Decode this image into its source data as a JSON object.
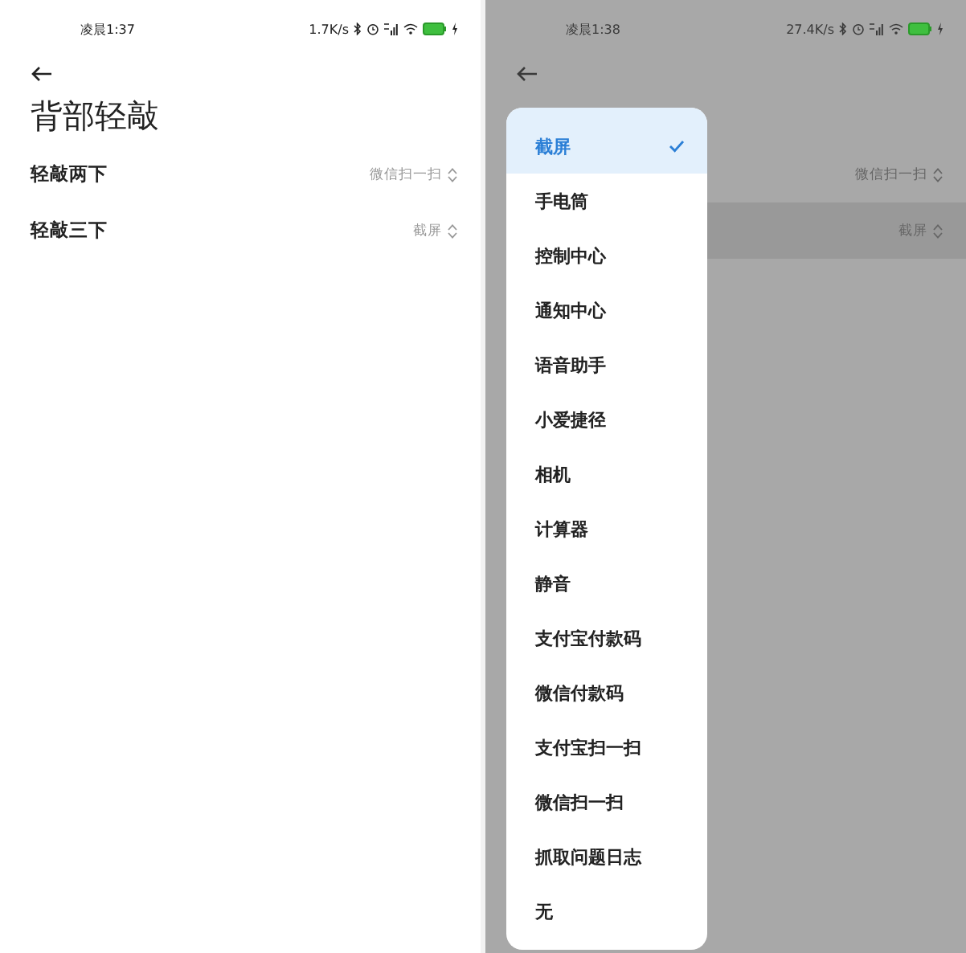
{
  "screens": [
    {
      "dimmed": false,
      "status_bar": {
        "time": "凌晨1:37",
        "net_speed": "1.7K/s"
      },
      "title": "背部轻敲",
      "settings": [
        {
          "label": "轻敲两下",
          "value": "微信扫一扫",
          "pressed": false
        },
        {
          "label": "轻敲三下",
          "value": "截屏",
          "pressed": false
        }
      ]
    },
    {
      "dimmed": true,
      "status_bar": {
        "time": "凌晨1:38",
        "net_speed": "27.4K/s"
      },
      "settings": [
        {
          "value": "微信扫一扫",
          "pressed": false
        },
        {
          "value": "截屏",
          "pressed": true
        }
      ],
      "menu": {
        "items": [
          {
            "label": "截屏",
            "selected": true
          },
          {
            "label": "手电筒",
            "selected": false
          },
          {
            "label": "控制中心",
            "selected": false
          },
          {
            "label": "通知中心",
            "selected": false
          },
          {
            "label": "语音助手",
            "selected": false
          },
          {
            "label": "小爱捷径",
            "selected": false
          },
          {
            "label": "相机",
            "selected": false
          },
          {
            "label": "计算器",
            "selected": false
          },
          {
            "label": "静音",
            "selected": false
          },
          {
            "label": "支付宝付款码",
            "selected": false
          },
          {
            "label": "微信付款码",
            "selected": false
          },
          {
            "label": "支付宝扫一扫",
            "selected": false
          },
          {
            "label": "微信扫一扫",
            "selected": false
          },
          {
            "label": "抓取问题日志",
            "selected": false
          },
          {
            "label": "无",
            "selected": false
          }
        ]
      }
    }
  ]
}
